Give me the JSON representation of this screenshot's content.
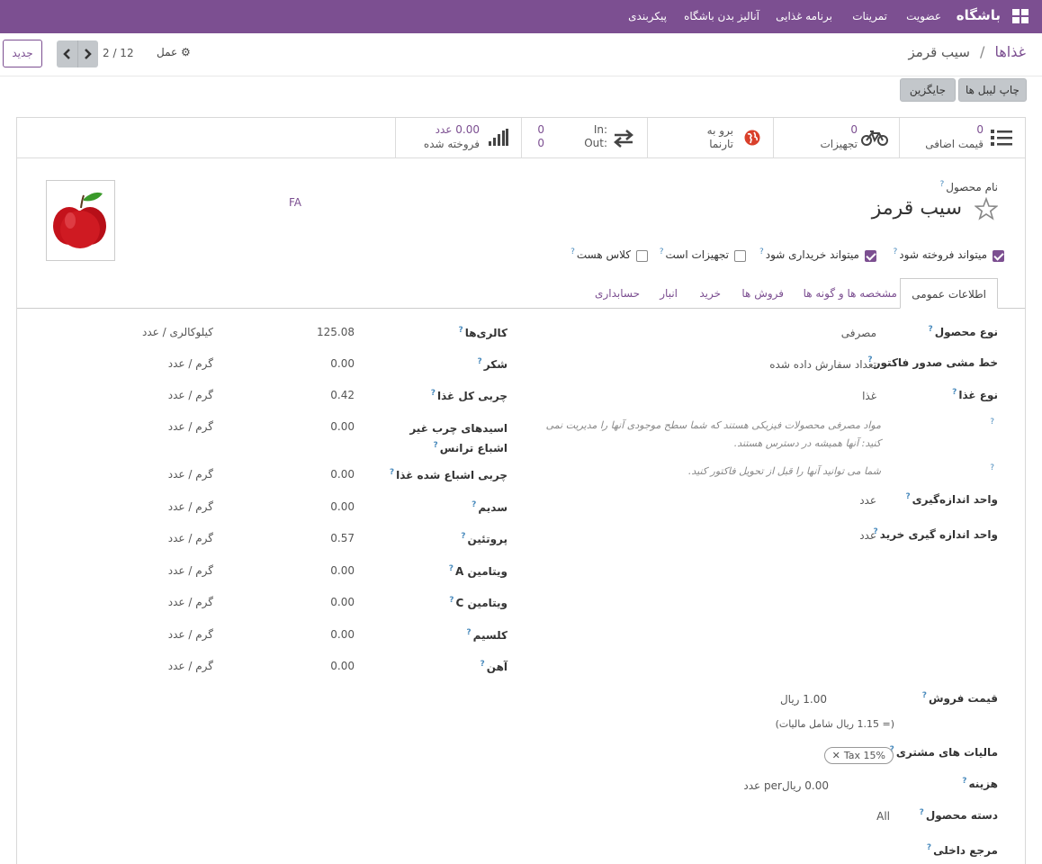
{
  "nav": {
    "brand": "باشگاه",
    "items": [
      "عضویت",
      "تمرینات",
      "برنامه غذایی",
      "آنالیز بدن باشگاه",
      "پیکربندی"
    ]
  },
  "breadcrumb": {
    "parent": "غذاها",
    "separator": "/",
    "current": "سیب قرمز"
  },
  "toolbar": {
    "new_label": "جدید",
    "action_label": "عمل",
    "pager": "2 / 12",
    "print_labels": "چاپ لیبل ها",
    "replenish": "جایگزین"
  },
  "stats": {
    "variants": {
      "count": "0",
      "label": "قیمت اضافی"
    },
    "equipment": {
      "count": "0",
      "label": "تجهیزات"
    },
    "website": {
      "line1": "برو به",
      "line2": "تارنما"
    },
    "inout": {
      "in_label": "In:",
      "in_value": "0",
      "out_label": "Out:",
      "out_value": "0"
    },
    "sold": {
      "value": "0.00 عدد",
      "label": "فروخته شده"
    }
  },
  "product": {
    "name_label": "نام محصول",
    "name": "سیب قرمز",
    "lang": "FA",
    "checkboxes": [
      {
        "label": "میتواند فروخته شود",
        "checked": true
      },
      {
        "label": "میتواند خریداری شود",
        "checked": true
      },
      {
        "label": "تجهیزات است",
        "checked": false
      },
      {
        "label": "کلاس هست",
        "checked": false
      }
    ]
  },
  "tabs": [
    "اطلاعات عمومی",
    "مشخصه ها و گونه ها",
    "فروش ها",
    "خرید",
    "انبار",
    "حسابداری"
  ],
  "general": {
    "product_type_label": "نوع محصول",
    "product_type": "مصرفی",
    "invoice_policy_label": "خط مشی صدور فاکتور",
    "invoice_policy": "تعداد سفارش داده شده",
    "food_type_label": "نوع غذا",
    "food_type": "غذا",
    "hint1_line1": "مواد مصرفی محصولات فیزیکی هستند که شما سطح موجودی آنها را مدیریت نمی",
    "hint1_line2": "کنید: آنها همیشه در دسترس هستند.",
    "hint2": "شما می توانید آنها را قبل از تحویل فاکتور کنید.",
    "uom_label": "واحد اندازه‌گیری",
    "uom": "عدد",
    "purchase_uom_label": "واحد اندازه گیری خرید",
    "purchase_uom": "عدد",
    "sale_price_label": "قیمت فروش",
    "sale_price": "1.00 ریال",
    "tax_included": "(= 1.15 ریال شامل مالیات)",
    "customer_taxes_label": "مالیات های مشتری",
    "tax_tag": "Tax 15%",
    "cost_label": "هزینه",
    "cost": "0.00 ریالper عدد",
    "category_label": "دسته محصول",
    "category": "All",
    "internal_ref_label": "مرجع داخلی"
  },
  "nutrition": [
    {
      "label": "کالری‌ها",
      "value": "125.08",
      "unit": "کیلوکالری / عدد"
    },
    {
      "label": "شکر",
      "value": "0.00",
      "unit": "گرم / عدد"
    },
    {
      "label": "چربی کل غذا",
      "value": "0.42",
      "unit": "گرم / عدد"
    },
    {
      "label": "اسیدهای چرب غیر اشباع ترانس",
      "value": "0.00",
      "unit": "گرم / عدد"
    },
    {
      "label": "چربی اشباع شده غذا",
      "value": "0.00",
      "unit": "گرم / عدد"
    },
    {
      "label": "سدیم",
      "value": "0.00",
      "unit": "گرم / عدد"
    },
    {
      "label": "پروتئین",
      "value": "0.57",
      "unit": "گرم / عدد"
    },
    {
      "label": "ویتامین A",
      "value": "0.00",
      "unit": "گرم / عدد"
    },
    {
      "label": "ویتامین C",
      "value": "0.00",
      "unit": "گرم / عدد"
    },
    {
      "label": "کلسیم",
      "value": "0.00",
      "unit": "گرم / عدد"
    },
    {
      "label": "آهن",
      "value": "0.00",
      "unit": "گرم / عدد"
    }
  ],
  "colors": {
    "brand": "#7c4f91",
    "help": "#4a8bbd"
  }
}
